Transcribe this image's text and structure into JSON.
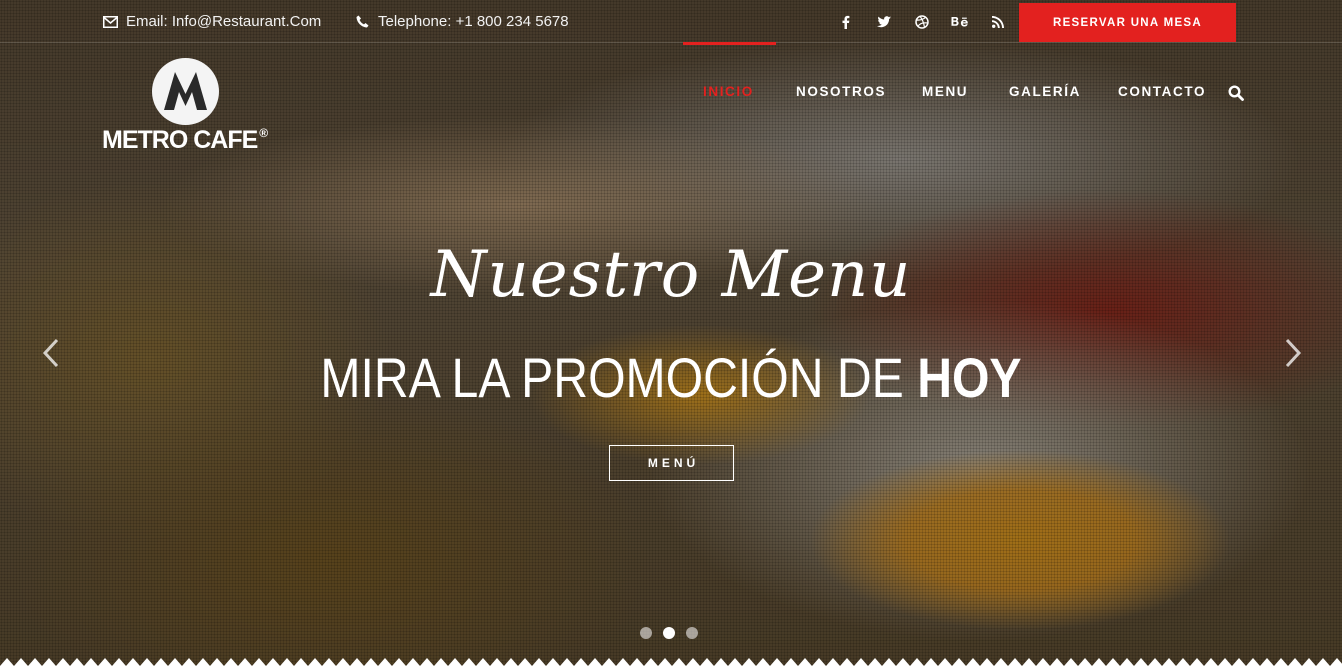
{
  "topbar": {
    "email": "Email: Info@Restaurant.Com",
    "phone": "Telephone: +1 800 234 5678",
    "social": [
      {
        "icon": "facebook-icon",
        "glyph": "f"
      },
      {
        "icon": "twitter-icon",
        "glyph": "t"
      },
      {
        "icon": "dribbble-icon",
        "glyph": "◎"
      },
      {
        "icon": "behance-icon",
        "glyph": "Bē"
      },
      {
        "icon": "rss-icon",
        "glyph": "rss"
      }
    ],
    "reserve_label": "RESERVAR UNA MESA"
  },
  "logo": {
    "text": "METRO CAFE",
    "reg": "®",
    "mark": "M"
  },
  "nav": {
    "items": [
      {
        "label": "INICIO",
        "active": true
      },
      {
        "label": "NOSOTROS",
        "active": false
      },
      {
        "label": "MENU",
        "active": false
      },
      {
        "label": "GALERÍA",
        "active": false
      },
      {
        "label": "CONTACTO",
        "active": false
      }
    ]
  },
  "slide": {
    "script_title": "Nuestro Menu",
    "headline_regular": "MIRA LA PROMOCIÓN DE ",
    "headline_bold": "HOY",
    "button_label": "MENÚ"
  },
  "slider": {
    "dot_count": 3,
    "active_dot": 2
  },
  "colors": {
    "accent": "#e3211f",
    "text": "#ffffff"
  }
}
